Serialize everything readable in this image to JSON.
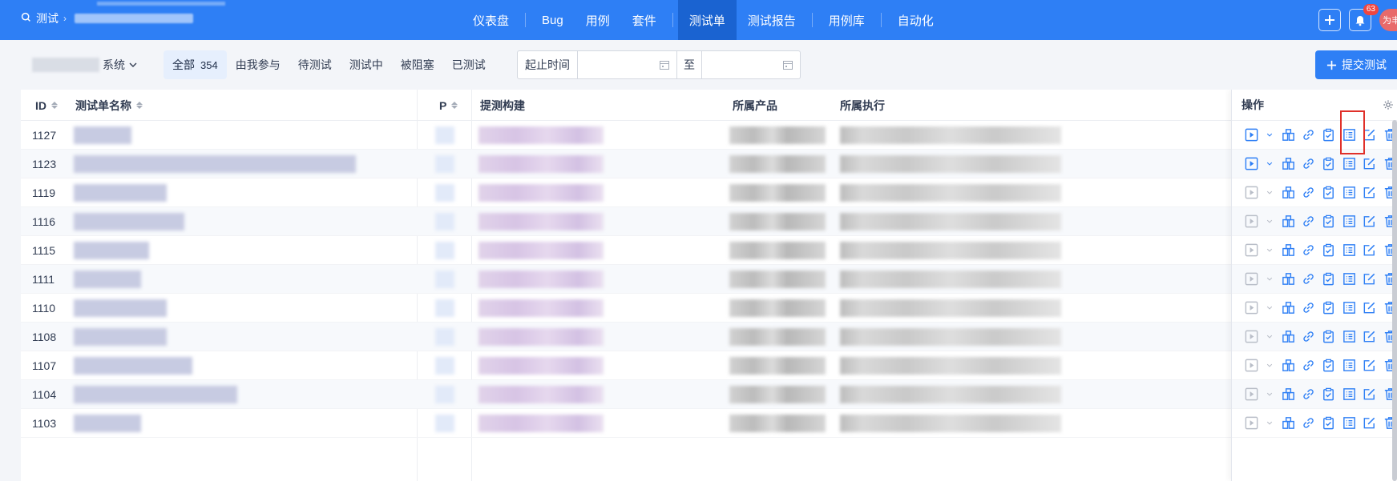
{
  "header": {
    "search_label": "测试",
    "nav": [
      {
        "label": "仪表盘",
        "active": false
      },
      {
        "label": "Bug",
        "active": false
      },
      {
        "label": "用例",
        "active": false
      },
      {
        "label": "套件",
        "active": false
      },
      {
        "label": "测试单",
        "active": true
      },
      {
        "label": "测试报告",
        "active": false
      },
      {
        "label": "用例库",
        "active": false
      },
      {
        "label": "自动化",
        "active": false
      }
    ],
    "notification_count": "63",
    "avatar_text": "为丰"
  },
  "toolbar": {
    "product_suffix": "系统",
    "tabs": [
      {
        "label": "全部",
        "count": "354",
        "active": true
      },
      {
        "label": "由我参与",
        "active": false
      },
      {
        "label": "待测试",
        "active": false
      },
      {
        "label": "测试中",
        "active": false
      },
      {
        "label": "被阻塞",
        "active": false
      },
      {
        "label": "已测试",
        "active": false
      }
    ],
    "date_label": "起止时间",
    "date_to": "至",
    "submit_label": "提交测试"
  },
  "table": {
    "columns": {
      "id": "ID",
      "name": "测试单名称",
      "pri": "P",
      "build": "提测构建",
      "product": "所属产品",
      "execution": "所属执行",
      "actions": "操作"
    },
    "rows": [
      {
        "id": "1127",
        "name_w": 72,
        "actions_enabled": true
      },
      {
        "id": "1123",
        "name_w": 352,
        "actions_enabled": true
      },
      {
        "id": "1119",
        "name_w": 116,
        "actions_enabled": false
      },
      {
        "id": "1116",
        "name_w": 138,
        "actions_enabled": false
      },
      {
        "id": "1115",
        "name_w": 94,
        "actions_enabled": false
      },
      {
        "id": "1111",
        "name_w": 84,
        "actions_enabled": false
      },
      {
        "id": "1110",
        "name_w": 116,
        "actions_enabled": false
      },
      {
        "id": "1108",
        "name_w": 116,
        "actions_enabled": false
      },
      {
        "id": "1107",
        "name_w": 148,
        "actions_enabled": false
      },
      {
        "id": "1104",
        "name_w": 204,
        "actions_enabled": false
      },
      {
        "id": "1103",
        "name_w": 84,
        "actions_enabled": false
      }
    ]
  },
  "colors": {
    "primary": "#2e7ff5",
    "highlight": "#e0302a",
    "icon_active": "#2e7ff5",
    "icon_disabled": "#b9bec8"
  }
}
